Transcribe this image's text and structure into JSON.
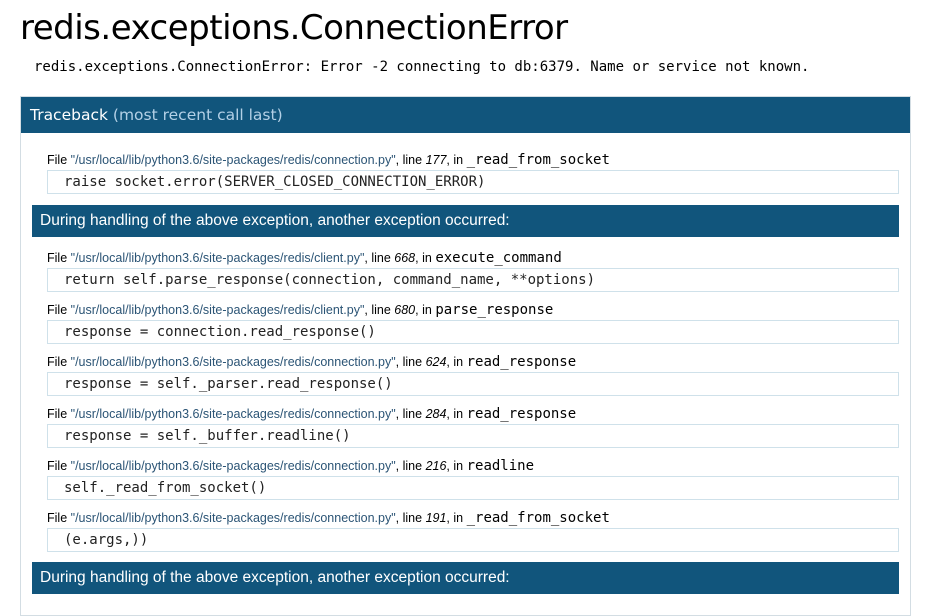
{
  "title": "redis.exceptions.ConnectionError",
  "error_message": "redis.exceptions.ConnectionError: Error -2 connecting to db:6379. Name or service not known.",
  "traceback": {
    "header": "Traceback",
    "header_sub": "(most recent call last)",
    "banner_text": "During handling of the above exception, another exception occurred:",
    "frames": [
      {
        "prefix": "File",
        "path": "\"/usr/local/lib/python3.6/site-packages/redis/connection.py\"",
        "line_word": ", line",
        "lineno": "177",
        "in_word": ", in",
        "function": "_read_from_socket",
        "code": "raise socket.error(SERVER_CLOSED_CONNECTION_ERROR)"
      },
      {
        "prefix": "File",
        "path": "\"/usr/local/lib/python3.6/site-packages/redis/client.py\"",
        "line_word": ", line",
        "lineno": "668",
        "in_word": ", in",
        "function": "execute_command",
        "code": "return self.parse_response(connection, command_name, **options)"
      },
      {
        "prefix": "File",
        "path": "\"/usr/local/lib/python3.6/site-packages/redis/client.py\"",
        "line_word": ", line",
        "lineno": "680",
        "in_word": ", in",
        "function": "parse_response",
        "code": "response = connection.read_response()"
      },
      {
        "prefix": "File",
        "path": "\"/usr/local/lib/python3.6/site-packages/redis/connection.py\"",
        "line_word": ", line",
        "lineno": "624",
        "in_word": ", in",
        "function": "read_response",
        "code": "response = self._parser.read_response()"
      },
      {
        "prefix": "File",
        "path": "\"/usr/local/lib/python3.6/site-packages/redis/connection.py\"",
        "line_word": ", line",
        "lineno": "284",
        "in_word": ", in",
        "function": "read_response",
        "code": "response = self._buffer.readline()"
      },
      {
        "prefix": "File",
        "path": "\"/usr/local/lib/python3.6/site-packages/redis/connection.py\"",
        "line_word": ", line",
        "lineno": "216",
        "in_word": ", in",
        "function": "readline",
        "code": "self._read_from_socket()"
      },
      {
        "prefix": "File",
        "path": "\"/usr/local/lib/python3.6/site-packages/redis/connection.py\"",
        "line_word": ", line",
        "lineno": "191",
        "in_word": ", in",
        "function": "_read_from_socket",
        "code": "(e.args,))"
      }
    ]
  },
  "colors": {
    "banner": "#11557c",
    "path": "#2b5475"
  }
}
